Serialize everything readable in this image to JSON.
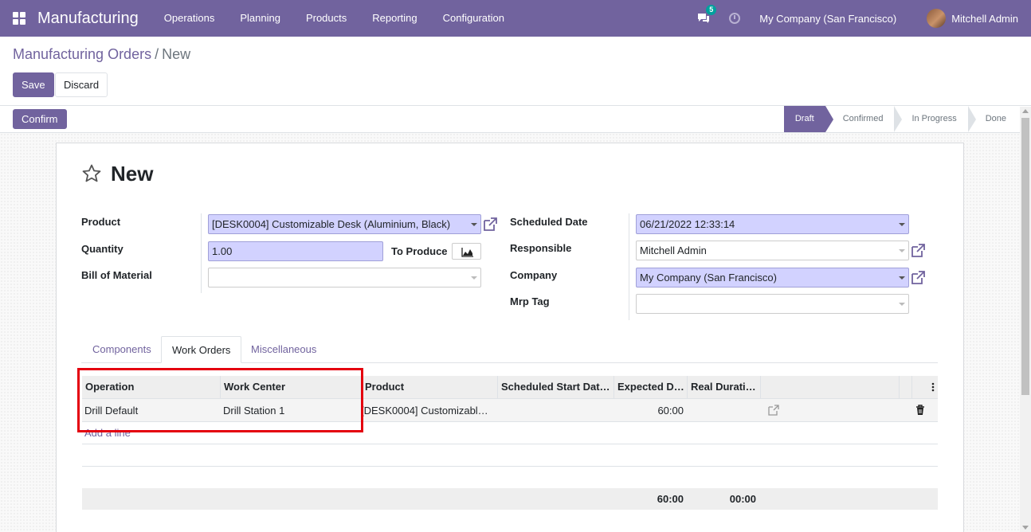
{
  "navbar": {
    "app_name": "Manufacturing",
    "menu": [
      "Operations",
      "Planning",
      "Products",
      "Reporting",
      "Configuration"
    ],
    "chat_count": "5",
    "company": "My Company (San Francisco)",
    "user": "Mitchell Admin"
  },
  "breadcrumb": {
    "parent": "Manufacturing Orders",
    "separator": "/",
    "current": "New"
  },
  "actions": {
    "save": "Save",
    "discard": "Discard",
    "confirm": "Confirm"
  },
  "statusbar": {
    "stages": [
      "Draft",
      "Confirmed",
      "In Progress",
      "Done"
    ],
    "active_stage": "Draft"
  },
  "record": {
    "title": "New"
  },
  "form": {
    "product_label": "Product",
    "product_value": "[DESK0004] Customizable Desk (Aluminium, Black)",
    "quantity_label": "Quantity",
    "quantity_value": "1.00",
    "to_produce_label": "To Produce",
    "bom_label": "Bill of Material",
    "bom_value": "",
    "scheduled_label": "Scheduled Date",
    "scheduled_value": "06/21/2022 12:33:14",
    "responsible_label": "Responsible",
    "responsible_value": "Mitchell Admin",
    "company_label": "Company",
    "company_value": "My Company (San Francisco)",
    "tag_label": "Mrp Tag",
    "tag_value": ""
  },
  "tabs": [
    {
      "label": "Components",
      "active": false
    },
    {
      "label": "Work Orders",
      "active": true
    },
    {
      "label": "Miscellaneous",
      "active": false
    }
  ],
  "table": {
    "columns": [
      "Operation",
      "Work Center",
      "Product",
      "Scheduled Start Dat…",
      "Expected D…",
      "Real Durati…"
    ],
    "rows": [
      {
        "operation": "Drill Default",
        "work_center": "Drill Station 1",
        "product": "[DESK0004] Customizabl…",
        "scheduled_start": "",
        "expected": "60:00",
        "real": ""
      }
    ],
    "add_line": "Add a line",
    "totals": {
      "expected": "60:00",
      "real": "00:00"
    }
  },
  "colors": {
    "brand": "#71639e",
    "required_field": "#d2d2ff",
    "highlight": "#e4000f",
    "badge": "#00a09d"
  }
}
